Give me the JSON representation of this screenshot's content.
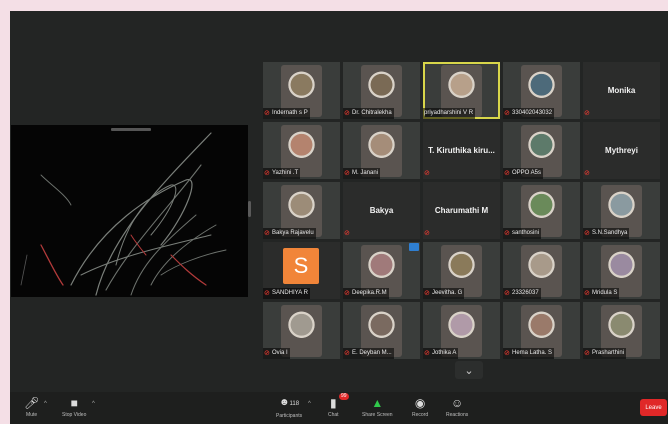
{
  "tiles": [
    {
      "name": "Indernath s P",
      "kind": "video",
      "tone": "#8a7a60",
      "mic": true,
      "active": false
    },
    {
      "name": "Dr. Chitralekha",
      "kind": "video",
      "tone": "#7a6a55",
      "mic": true,
      "active": false
    },
    {
      "name": "priyadharshini V R",
      "kind": "video",
      "tone": "#b7a08a",
      "mic": false,
      "active": true
    },
    {
      "name": "330402043032",
      "kind": "video",
      "tone": "#4d6a7a",
      "mic": true,
      "active": false
    },
    {
      "name": "Monika",
      "kind": "name",
      "mic": true,
      "active": false
    },
    {
      "name": "Yazhini .T",
      "kind": "video",
      "tone": "#b4836e",
      "mic": true,
      "active": false
    },
    {
      "name": "M. Janani",
      "kind": "video",
      "tone": "#a58d79",
      "mic": true,
      "active": false
    },
    {
      "name": "T. Kiruthika kiru...",
      "kind": "name",
      "mic": true,
      "active": false
    },
    {
      "name": "OPPO A5s",
      "kind": "video",
      "tone": "#5d7a6a",
      "mic": true,
      "active": false
    },
    {
      "name": "Mythreyi",
      "kind": "name",
      "mic": true,
      "active": false
    },
    {
      "name": "Bakya Rajavelu",
      "kind": "video",
      "tone": "#9c8c78",
      "mic": true,
      "active": false
    },
    {
      "name": "Bakya",
      "kind": "name",
      "mic": true,
      "active": false
    },
    {
      "name": "Charumathi M",
      "kind": "name",
      "mic": true,
      "active": false
    },
    {
      "name": "santhosini",
      "kind": "video",
      "tone": "#6a8a5a",
      "mic": true,
      "active": false
    },
    {
      "name": "S.N.Sandhya",
      "kind": "video",
      "tone": "#8a9aa0",
      "mic": true,
      "active": false
    },
    {
      "name": "SANDHIYA R",
      "kind": "avatar",
      "initial": "S",
      "mic": true,
      "active": false
    },
    {
      "name": "Deepika.R.M",
      "kind": "video",
      "tone": "#a07a7a",
      "mic": true,
      "active": false,
      "badge": true
    },
    {
      "name": "Jeevitha. G",
      "kind": "video",
      "tone": "#8a7a5a",
      "mic": true,
      "active": false
    },
    {
      "name": "23326037",
      "kind": "video",
      "tone": "#a89a8a",
      "mic": true,
      "active": false
    },
    {
      "name": "Mridula S",
      "kind": "video",
      "tone": "#9a8aa0",
      "mic": true,
      "active": false
    },
    {
      "name": "Ovia I",
      "kind": "video",
      "tone": "#a09a90",
      "mic": true,
      "active": false
    },
    {
      "name": "E. Deyban M...",
      "kind": "video",
      "tone": "#7a6a60",
      "mic": true,
      "active": false
    },
    {
      "name": "Jothika A",
      "kind": "video",
      "tone": "#b09aa8",
      "mic": true,
      "active": false
    },
    {
      "name": "Hema Latha. S",
      "kind": "video",
      "tone": "#9a7a6a",
      "mic": true,
      "active": false
    },
    {
      "name": "Prasharthini",
      "kind": "video",
      "tone": "#8a8a70",
      "mic": true,
      "active": false
    }
  ],
  "toolbar": {
    "mute": "Mute",
    "stop_video": "Stop Video",
    "participants_count": "118",
    "participants": "Participants",
    "chat": "Chat",
    "chat_badge": "99",
    "share_screen": "Share Screen",
    "record": "Record",
    "reactions": "Reactions",
    "leave": "Leave"
  },
  "colors": {
    "share_screen": "#30c94b",
    "leave": "#e02828",
    "active_speaker": "#d8d64a"
  }
}
